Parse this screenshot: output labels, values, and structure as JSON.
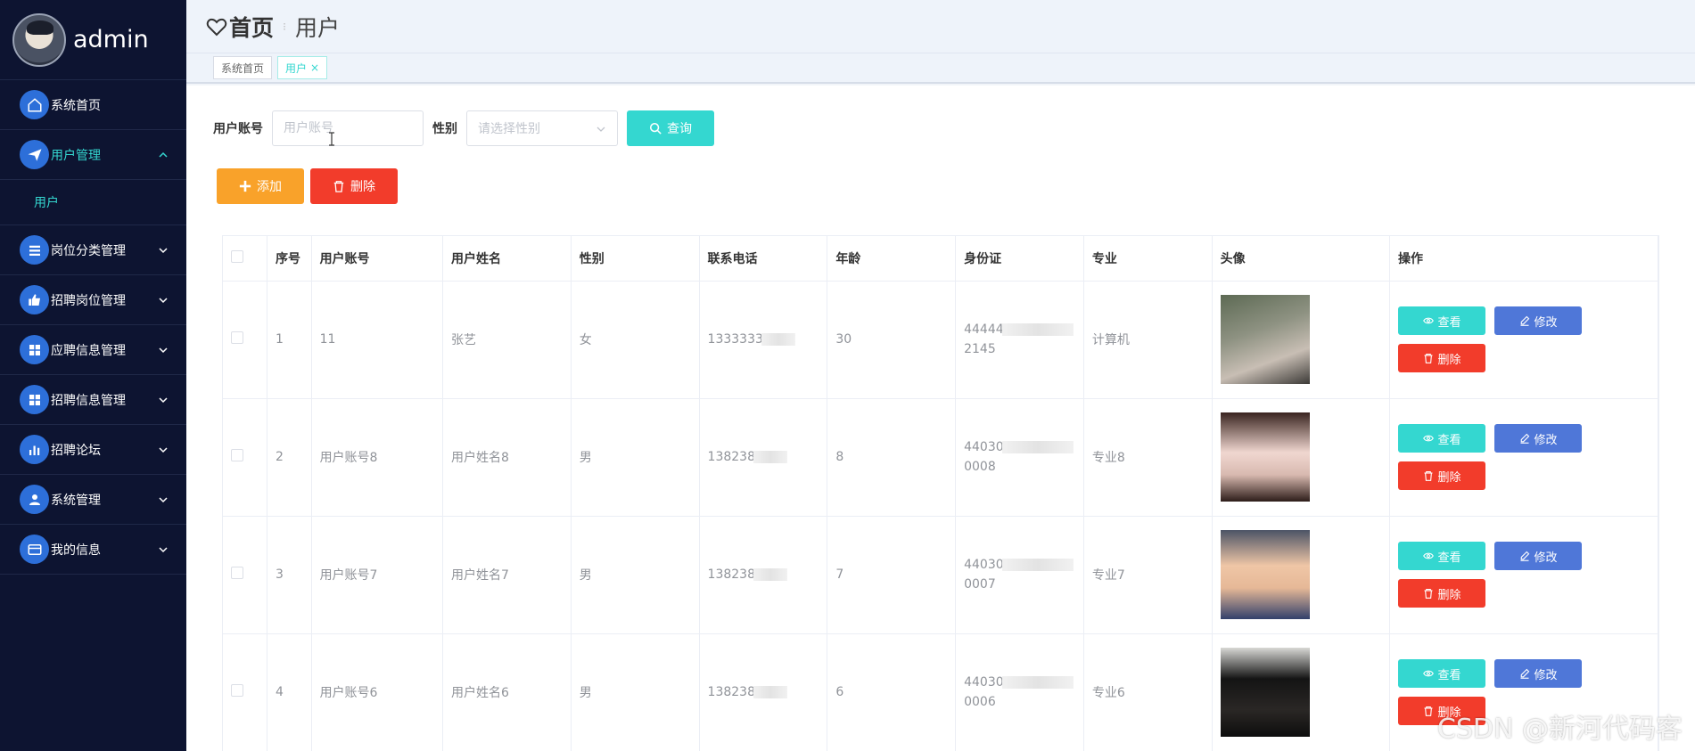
{
  "sidebar": {
    "username": "admin",
    "items": [
      {
        "label": "系统首页",
        "icon": "home-icon",
        "expandable": false
      },
      {
        "label": "用户管理",
        "icon": "paper-plane-icon",
        "expandable": true,
        "active": true
      },
      {
        "label": "岗位分类管理",
        "icon": "list-icon",
        "expandable": true
      },
      {
        "label": "招聘岗位管理",
        "icon": "thumbs-up-icon",
        "expandable": true
      },
      {
        "label": "应聘信息管理",
        "icon": "grid-icon",
        "expandable": true
      },
      {
        "label": "招聘信息管理",
        "icon": "grid-icon",
        "expandable": true
      },
      {
        "label": "招聘论坛",
        "icon": "bar-chart-icon",
        "expandable": true
      },
      {
        "label": "系统管理",
        "icon": "user-icon",
        "expandable": true
      },
      {
        "label": "我的信息",
        "icon": "card-icon",
        "expandable": true
      }
    ],
    "submenu": {
      "label": "用户"
    }
  },
  "header": {
    "home": "首页",
    "current": "用户"
  },
  "tags": [
    {
      "label": "系统首页"
    },
    {
      "label": "用户"
    }
  ],
  "search": {
    "account_label": "用户账号",
    "account_placeholder": "用户账号",
    "gender_label": "性别",
    "gender_placeholder": "请选择性别",
    "query_button": "查询"
  },
  "actions": {
    "add": "添加",
    "delete": "删除"
  },
  "table": {
    "columns": [
      "序号",
      "用户账号",
      "用户姓名",
      "性别",
      "联系电话",
      "年龄",
      "身份证",
      "专业",
      "头像",
      "操作"
    ],
    "rows": [
      {
        "no": "1",
        "account": "11",
        "name": "张艺",
        "gender": "女",
        "phone": "1333333",
        "age": "30",
        "id_top": "44444",
        "id_bottom": "2145",
        "major": "计算机"
      },
      {
        "no": "2",
        "account": "用户账号8",
        "name": "用户姓名8",
        "gender": "男",
        "phone": "138238",
        "age": "8",
        "id_top": "44030",
        "id_bottom": "0008",
        "major": "专业8"
      },
      {
        "no": "3",
        "account": "用户账号7",
        "name": "用户姓名7",
        "gender": "男",
        "phone": "138238",
        "age": "7",
        "id_top": "44030",
        "id_bottom": "0007",
        "major": "专业7"
      },
      {
        "no": "4",
        "account": "用户账号6",
        "name": "用户姓名6",
        "gender": "男",
        "phone": "138238",
        "age": "6",
        "id_top": "44030",
        "id_bottom": "0006",
        "major": "专业6"
      }
    ],
    "row_actions": {
      "view": "查看",
      "edit": "修改",
      "delete": "删除"
    }
  },
  "watermark": "CSDN @新河代码客",
  "colors": {
    "sidebar_bg": "#0d1431",
    "accent": "#34d7d0",
    "warning": "#f9a22a",
    "danger": "#f23c2b",
    "primary": "#4f77d8"
  }
}
